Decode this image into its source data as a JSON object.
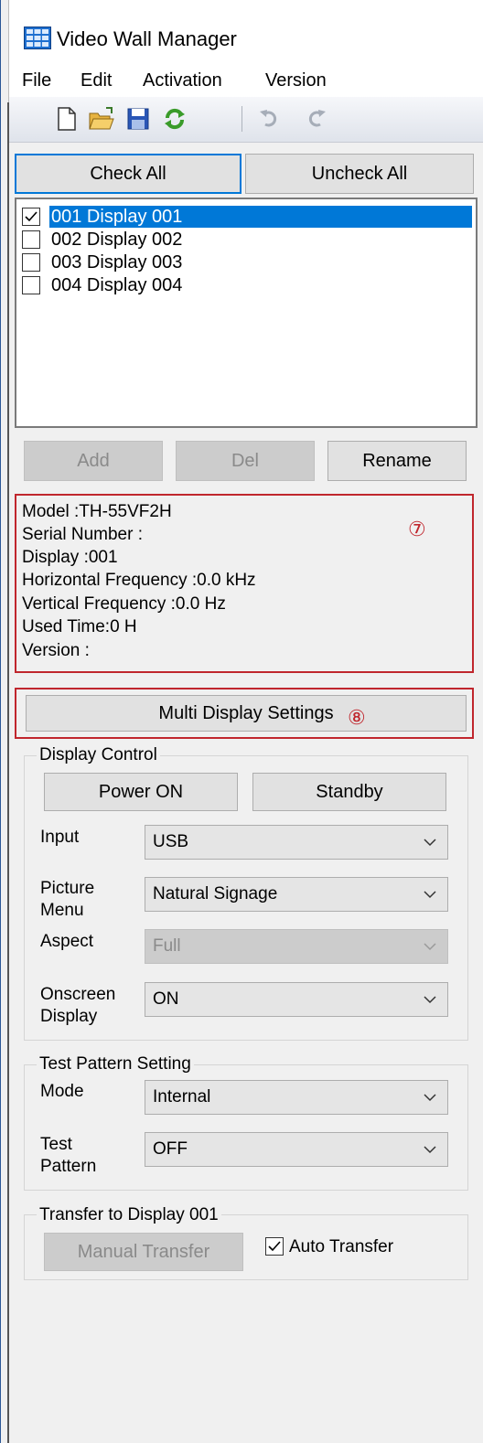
{
  "window": {
    "title": "Video Wall Manager"
  },
  "menu": [
    "File",
    "Edit",
    "Activation",
    "Version"
  ],
  "toolbar": {
    "icons": [
      "new-file-icon",
      "open-folder-icon",
      "save-icon",
      "refresh-icon",
      "undo-icon",
      "redo-icon"
    ]
  },
  "check_buttons": {
    "check_all": "Check All",
    "uncheck_all": "Uncheck All"
  },
  "displays": [
    {
      "label": "001 Display 001",
      "checked": true,
      "selected": true
    },
    {
      "label": "002 Display 002",
      "checked": false,
      "selected": false
    },
    {
      "label": "003 Display 003",
      "checked": false,
      "selected": false
    },
    {
      "label": "004 Display 004",
      "checked": false,
      "selected": false
    }
  ],
  "list_buttons": {
    "add": "Add",
    "del": "Del",
    "rename": "Rename"
  },
  "info": {
    "model": "Model :TH-55VF2H",
    "serial": "Serial Number :",
    "display": "Display :001",
    "hfreq": "Horizontal Frequency :0.0 kHz",
    "vfreq": "Vertical Frequency :0.0 Hz",
    "used_time": "Used Time:0 H",
    "version": "Version :"
  },
  "callouts": {
    "seven": "⑦",
    "eight": "⑧"
  },
  "multi_display_label": "Multi Display Settings",
  "display_control": {
    "title": "Display Control",
    "power_on": "Power ON",
    "standby": "Standby",
    "input_label": "Input",
    "input_value": "USB",
    "picture_label_1": "Picture",
    "picture_label_2": "Menu",
    "picture_value": "Natural Signage",
    "aspect_label": "Aspect",
    "aspect_value": "Full",
    "osd_label_1": "Onscreen",
    "osd_label_2": "Display",
    "osd_value": "ON"
  },
  "test_pattern": {
    "title": "Test Pattern Setting",
    "mode_label": "Mode",
    "mode_value": "Internal",
    "pattern_label_1": "Test",
    "pattern_label_2": "Pattern",
    "pattern_value": "OFF"
  },
  "transfer": {
    "title": "Transfer to Display 001",
    "manual": "Manual Transfer",
    "auto": "Auto Transfer",
    "auto_checked": true
  },
  "colors": {
    "accent": "#0078d7",
    "annotation": "#c0262d"
  }
}
